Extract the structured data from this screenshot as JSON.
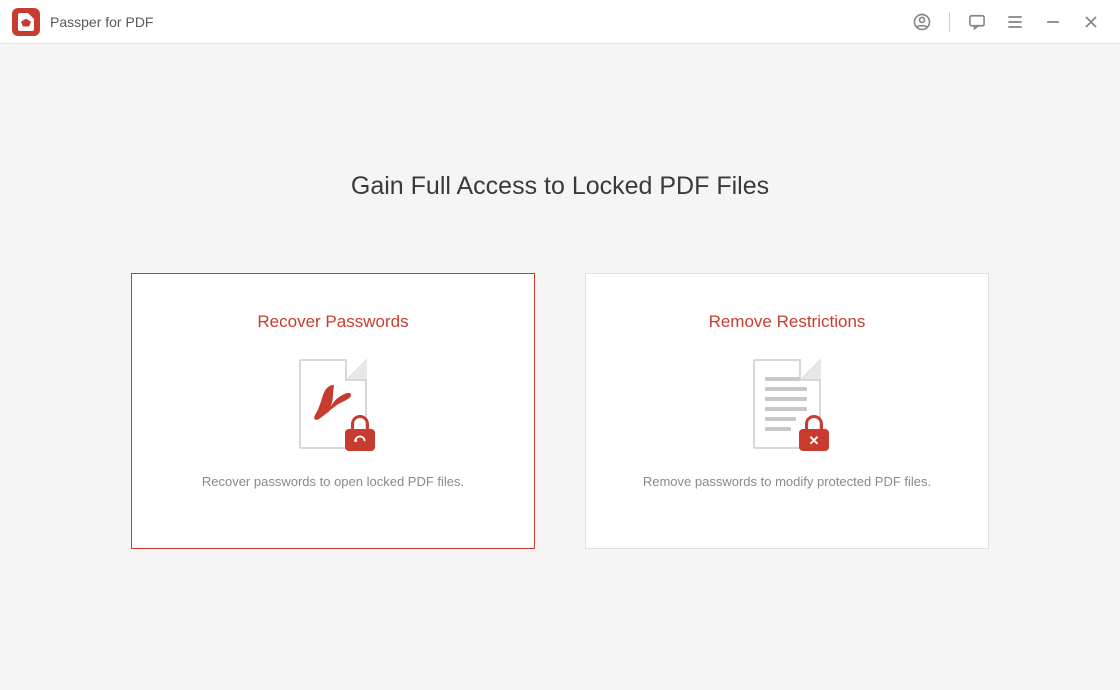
{
  "app": {
    "title": "Passper for PDF"
  },
  "main": {
    "heading": "Gain Full Access to Locked PDF Files"
  },
  "cards": {
    "recover": {
      "title": "Recover Passwords",
      "description": "Recover passwords to open locked PDF files."
    },
    "remove": {
      "title": "Remove Restrictions",
      "description": "Remove passwords to modify protected PDF files."
    }
  },
  "colors": {
    "accent": "#c83c2f",
    "text_primary": "#3a3a3a",
    "text_secondary": "#8a8a8a"
  }
}
